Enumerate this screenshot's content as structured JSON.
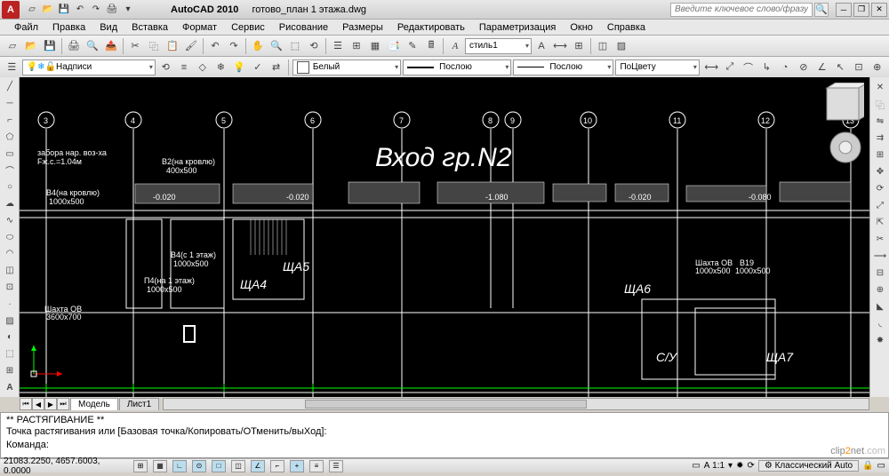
{
  "title": {
    "app": "AutoCAD 2010",
    "file": "готово_план 1 этажа.dwg"
  },
  "search": {
    "placeholder": "Введите ключевое слово/фразу"
  },
  "menu": [
    "Файл",
    "Правка",
    "Вид",
    "Вставка",
    "Формат",
    "Сервис",
    "Рисование",
    "Размеры",
    "Редактировать",
    "Параметризация",
    "Окно",
    "Справка"
  ],
  "style_combo": "стиль1",
  "layer_combo": "Надписи",
  "color_combo": "Белый",
  "lineweight_combo": "Послою",
  "linetype_combo": "Послою",
  "plotstyle_combo": "ПоЦвету",
  "drawing": {
    "main_label": "Вход гр.N2",
    "axes": [
      "3",
      "4",
      "5",
      "6",
      "7",
      "8",
      "9",
      "10",
      "11",
      "12",
      "13"
    ],
    "notes": {
      "zabor": "забора нар. воз-ха",
      "fzhs": "Fж.с.=1.04м",
      "b2": "B2(на кровлю)",
      "b2d": "400х500",
      "b4": "B4(на кровлю)",
      "b4d": "1000х500",
      "b4c": "B4(с 1 этаж)",
      "b4cd": "1000х500",
      "p4": "П4(на 1 этаж)",
      "p4d": "1000х500",
      "shahta": "Шахта ОВ",
      "shahtad": "3600х700",
      "shahta2": "Шахта ОВ",
      "shahta2d": "1000х500",
      "b19": "B19",
      "b19d": "1000х500",
      "scha4": "ЩА4",
      "scha5": "ЩА5",
      "scha6": "ЩА6",
      "scha7": "ЩА7",
      "su": "С/У",
      "lev1": "-0.020",
      "lev2": "-0.020",
      "lev3": "-1.080",
      "lev4": "-0.020",
      "lev5": "-0.080"
    }
  },
  "tabs": {
    "model": "Модель",
    "sheet1": "Лист1"
  },
  "cmd": {
    "l1": "** РАСТЯГИВАНИЕ **",
    "l2": "Точка растягивания или [Базовая точка/Копировать/ОТменить/выХод]:",
    "l3": "Команда:"
  },
  "status": {
    "coords": "21083.2250, 4657.6003, 0.0000",
    "workspace": "Классический Auto",
    "scale": "А 1:1"
  },
  "watermark": {
    "a": "clip",
    "b": "2",
    "c": "net",
    "d": ".com"
  }
}
